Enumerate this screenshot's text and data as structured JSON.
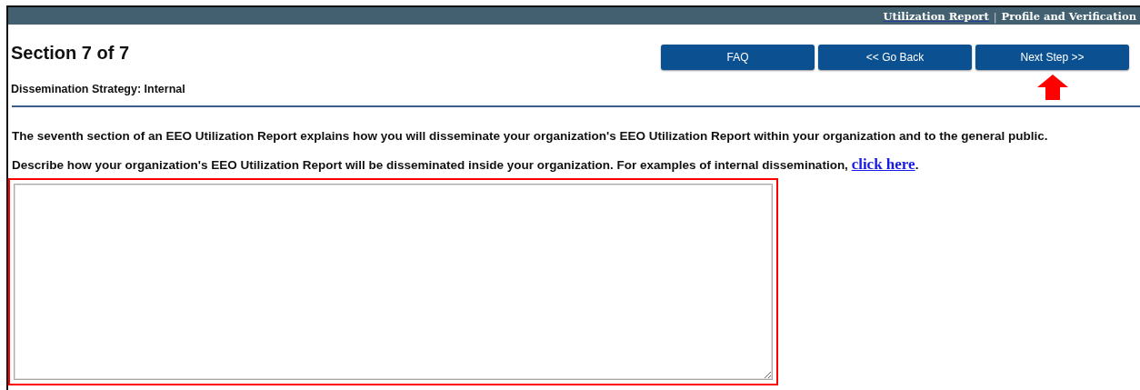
{
  "header_links": [
    {
      "label": "Utilization Report",
      "kind": "underlined"
    },
    {
      "label": "Profile and Verification",
      "kind": "plain"
    }
  ],
  "header_separator": "|",
  "title": "Section 7 of 7",
  "subtitle": "Dissemination Strategy: Internal",
  "buttons": [
    {
      "label": "FAQ",
      "highlighted": false
    },
    {
      "label": "<< Go Back",
      "highlighted": false
    },
    {
      "label": "Next Step >>",
      "highlighted": true
    }
  ],
  "intro": "The seventh section of an EEO Utilization Report explains how you will disseminate your organization's EEO Utilization Report within your organization and to the general public.",
  "prompt": {
    "text": "Describe how your organization's EEO Utilization Report will be disseminated inside your organization. For examples of internal dissemination, ",
    "link": "click here",
    "after": "."
  },
  "answer": {
    "highlighted": true
  }
}
